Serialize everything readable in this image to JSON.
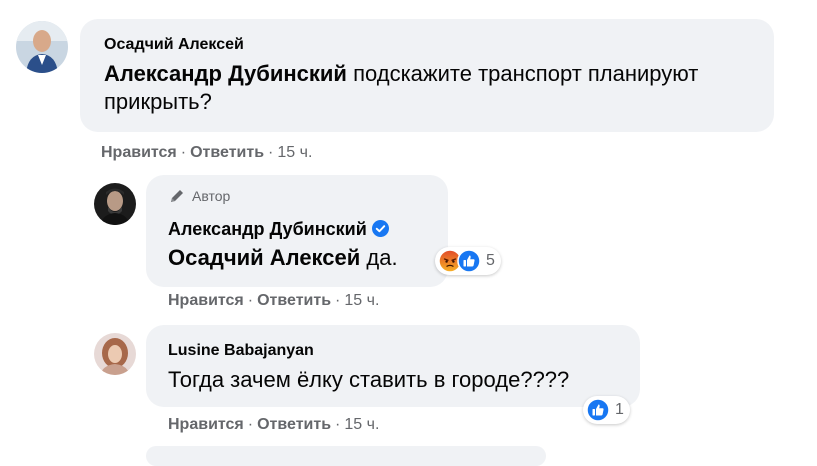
{
  "comments": [
    {
      "author": "Осадчий Алексей",
      "mention": "Александр Дубинский",
      "text": " подскажите транспорт планируют прикрыть?",
      "actions": {
        "like": "Нравится",
        "reply": "Ответить",
        "time": "15 ч."
      }
    },
    {
      "badge": "Автор",
      "author": "Александр Дубинский",
      "mention": "Осадчий Алексей",
      "text": " да.",
      "reactions": {
        "icons": [
          "angry-icon",
          "like-icon"
        ],
        "count": "5"
      },
      "actions": {
        "like": "Нравится",
        "reply": "Ответить",
        "time": "15 ч."
      }
    },
    {
      "author": "Lusine Babajanyan",
      "text": "Тогда зачем ёлку ставить в городе????",
      "reactions": {
        "icons": [
          "like-icon"
        ],
        "count": "1"
      },
      "actions": {
        "like": "Нравится",
        "reply": "Ответить",
        "time": "15 ч."
      }
    }
  ],
  "colors": {
    "bubble": "#f0f2f5",
    "secondary_text": "#65676b",
    "like_blue": "#1877f2",
    "angry_orange": "#e9710f"
  }
}
